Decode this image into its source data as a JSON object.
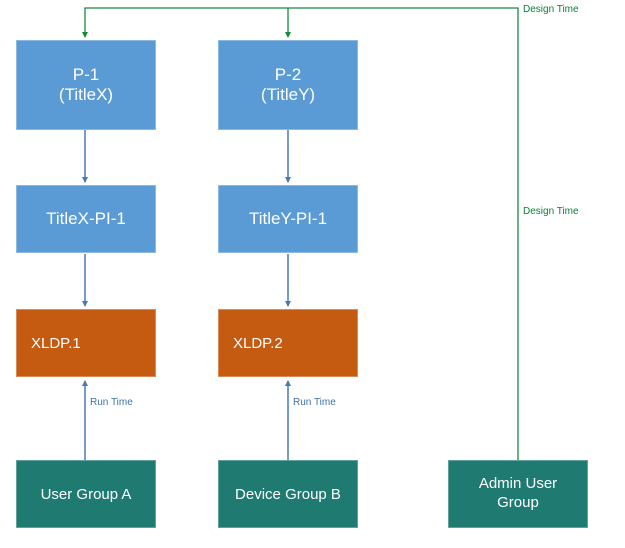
{
  "colors": {
    "blue_fill": "#5b9bd5",
    "orange_fill": "#c55a11",
    "teal_fill": "#1f7a72",
    "arrow_blue": "#4a7ab0",
    "arrow_green": "#188a3e"
  },
  "labels": {
    "design_time_top": "Design Time",
    "design_time_side": "Design Time",
    "run_time_left": "Run Time",
    "run_time_right": "Run Time"
  },
  "nodes": {
    "p1": {
      "line1": "P-1",
      "line2": "(TitleX)"
    },
    "p2": {
      "line1": "P-2",
      "line2": "(TitleY)"
    },
    "pi1": "TitleX-PI-1",
    "pi2": "TitleY-PI-1",
    "xldp1": "XLDP.1",
    "xldp2": "XLDP.2",
    "ug_a": "User Group A",
    "dg_b": "Device Group B",
    "admin": {
      "line1": "Admin User",
      "line2": "Group"
    }
  },
  "edges": [
    {
      "from": "p1",
      "to": "pi1",
      "style": "blue"
    },
    {
      "from": "p2",
      "to": "pi2",
      "style": "blue"
    },
    {
      "from": "pi1",
      "to": "xldp1",
      "style": "blue"
    },
    {
      "from": "pi2",
      "to": "xldp2",
      "style": "blue"
    },
    {
      "from": "ug_a",
      "to": "xldp1",
      "style": "blue",
      "label": "Run Time"
    },
    {
      "from": "dg_b",
      "to": "xldp2",
      "style": "blue",
      "label": "Run Time"
    },
    {
      "from": "admin",
      "to": "p1",
      "style": "green",
      "label": "Design Time"
    },
    {
      "from": "admin",
      "to": "p2",
      "style": "green",
      "label": "Design Time"
    }
  ]
}
